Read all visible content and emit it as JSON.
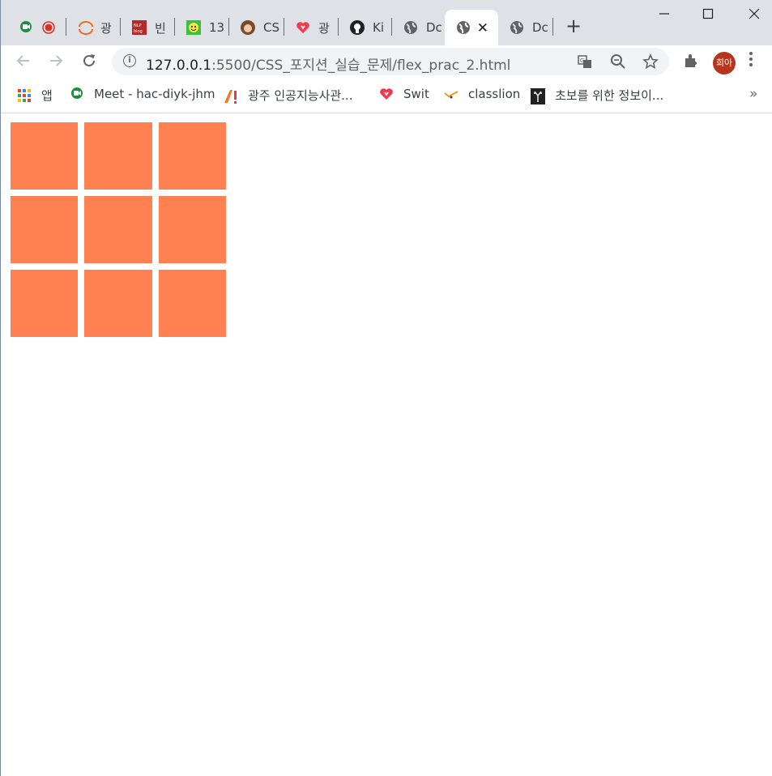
{
  "browser": {
    "tabs": [
      {
        "label": "",
        "favicon": "meet-icon"
      },
      {
        "label": "광",
        "favicon": "orange-arc-icon"
      },
      {
        "label": "빈",
        "favicon": "nlp-blog-icon"
      },
      {
        "label": "13",
        "favicon": "smiley-icon"
      },
      {
        "label": "CS",
        "favicon": "avatar-icon"
      },
      {
        "label": "광",
        "favicon": "swit-heart-icon"
      },
      {
        "label": "Ki",
        "favicon": "github-icon"
      },
      {
        "label": "Dc",
        "favicon": "globe-icon"
      },
      {
        "label": "",
        "favicon": "globe-icon",
        "active": true
      },
      {
        "label": "Dc",
        "favicon": "globe-icon"
      }
    ],
    "url_host": "127.0.0.1",
    "url_rest": ":5500/CSS_포지션_실습_문제/flex_prac_2.html",
    "profile_label": "희아",
    "bookmarks": [
      {
        "label": "앱",
        "icon": "apps-grid-icon"
      },
      {
        "label": "Meet - hac-diyk-jhm",
        "icon": "meet-icon"
      },
      {
        "label": "광주 인공지능사관...",
        "icon": "ai-logo-icon"
      },
      {
        "label": "Swit",
        "icon": "swit-heart-icon"
      },
      {
        "label": "classlion",
        "icon": "classlion-icon"
      },
      {
        "label": "초보를 위한 정보이...",
        "icon": "deer-icon"
      }
    ],
    "bookmarks_overflow": "»"
  },
  "page": {
    "box_color": "#ff8051",
    "box_count": 9
  }
}
